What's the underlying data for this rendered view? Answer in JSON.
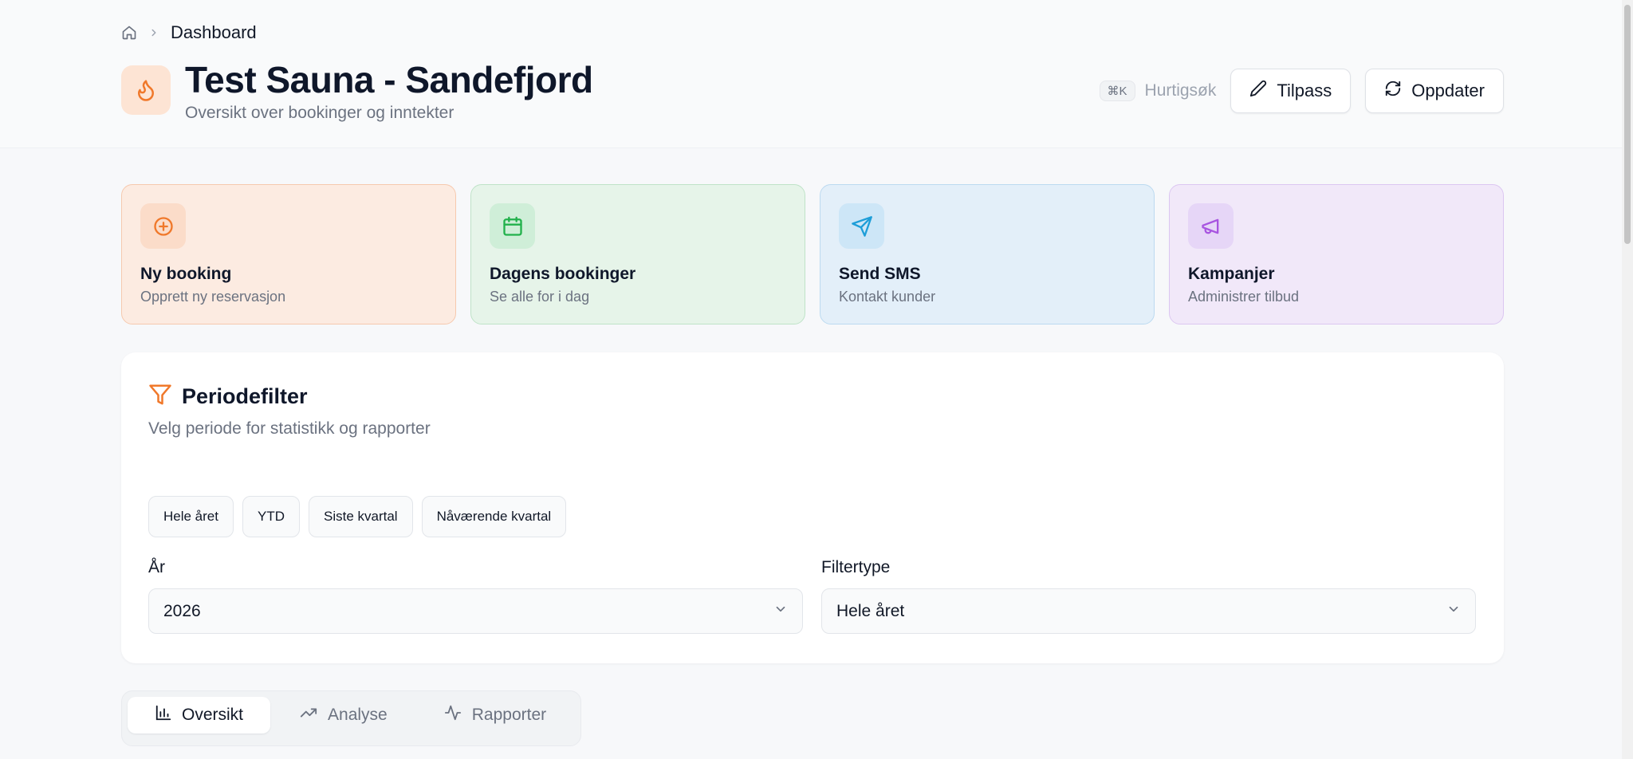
{
  "breadcrumb": {
    "current": "Dashboard"
  },
  "header": {
    "title": "Test Sauna - Sandefjord",
    "subtitle": "Oversikt over bookinger og inntekter",
    "shortcut": "⌘K",
    "quick_search": "Hurtigsøk",
    "customize_label": "Tilpass",
    "refresh_label": "Oppdater"
  },
  "quick_actions": [
    {
      "title": "Ny booking",
      "subtitle": "Opprett ny reservasjon",
      "icon": "plus-circle-icon",
      "color": "#f0782a"
    },
    {
      "title": "Dagens bookinger",
      "subtitle": "Se alle for i dag",
      "icon": "calendar-icon",
      "color": "#22b14c"
    },
    {
      "title": "Send SMS",
      "subtitle": "Kontakt kunder",
      "icon": "send-icon",
      "color": "#1e9ed8"
    },
    {
      "title": "Kampanjer",
      "subtitle": "Administrer tilbud",
      "icon": "megaphone-icon",
      "color": "#a855e0"
    }
  ],
  "filter": {
    "title": "Periodefilter",
    "description": "Velg periode for statistikk og rapporter",
    "quick_ranges": [
      "Hele året",
      "YTD",
      "Siste kvartal",
      "Nåværende kvartal"
    ],
    "year_label": "År",
    "year_value": "2026",
    "type_label": "Filtertype",
    "type_value": "Hele året"
  },
  "tabs": [
    {
      "label": "Oversikt",
      "icon": "bar-chart-icon",
      "active": true
    },
    {
      "label": "Analyse",
      "icon": "trending-up-icon",
      "active": false
    },
    {
      "label": "Rapporter",
      "icon": "activity-icon",
      "active": false
    }
  ]
}
